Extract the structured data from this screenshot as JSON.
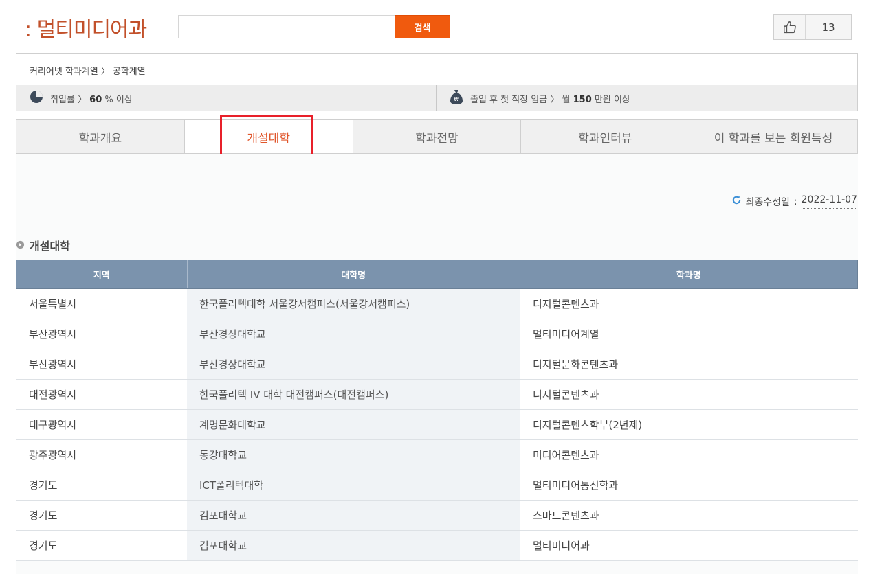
{
  "header": {
    "title": ": 멀티미디어과",
    "search_value": "",
    "search_button": "검색",
    "like_count": "13"
  },
  "info": {
    "breadcrumb": [
      "커리어넷 학과계열",
      "〉",
      "공학계열"
    ],
    "employment_label": "취업률",
    "employment_value": "60",
    "employment_unit": "% 이상",
    "salary_label": "졸업 후 첫 직장 임금",
    "salary_prefix": "월",
    "salary_value": "150",
    "salary_unit": "만원 이상"
  },
  "tabs": [
    {
      "label": "학과개요"
    },
    {
      "label": "개설대학"
    },
    {
      "label": "학과전망"
    },
    {
      "label": "학과인터뷰"
    },
    {
      "label": "이 학과를 보는 회원특성"
    }
  ],
  "updated": {
    "label": "최종수정일",
    "separator": ":",
    "date": "2022-11-07"
  },
  "section": {
    "title": "개설대학"
  },
  "table": {
    "headers": [
      "지역",
      "대학명",
      "학과명"
    ],
    "rows": [
      [
        "서울특별시",
        "한국폴리텍대학 서울강서캠퍼스(서울강서캠퍼스)",
        "디지털콘텐츠과"
      ],
      [
        "부산광역시",
        "부산경상대학교",
        "멀티미디어계열"
      ],
      [
        "부산광역시",
        "부산경상대학교",
        "디지털문화콘텐츠과"
      ],
      [
        "대전광역시",
        "한국폴리텍 IV 대학 대전캠퍼스(대전캠퍼스)",
        "디지털콘텐츠과"
      ],
      [
        "대구광역시",
        "계명문화대학교",
        "디지털콘텐츠학부(2년제)"
      ],
      [
        "광주광역시",
        "동강대학교",
        "미디어콘텐츠과"
      ],
      [
        "경기도",
        "ICT폴리텍대학",
        "멀티미디어통신학과"
      ],
      [
        "경기도",
        "김포대학교",
        "스마트콘텐츠과"
      ],
      [
        "경기도",
        "김포대학교",
        "멀티미디어과"
      ]
    ]
  },
  "colors": {
    "accent": "#f05a0e",
    "title": "#c2502a",
    "table_header": "#7b93ad",
    "highlight": "#e8202a"
  },
  "icons": [
    "thumbs-up-icon",
    "pie-chart-icon",
    "money-bag-icon",
    "refresh-icon",
    "bullet-circle-icon"
  ]
}
